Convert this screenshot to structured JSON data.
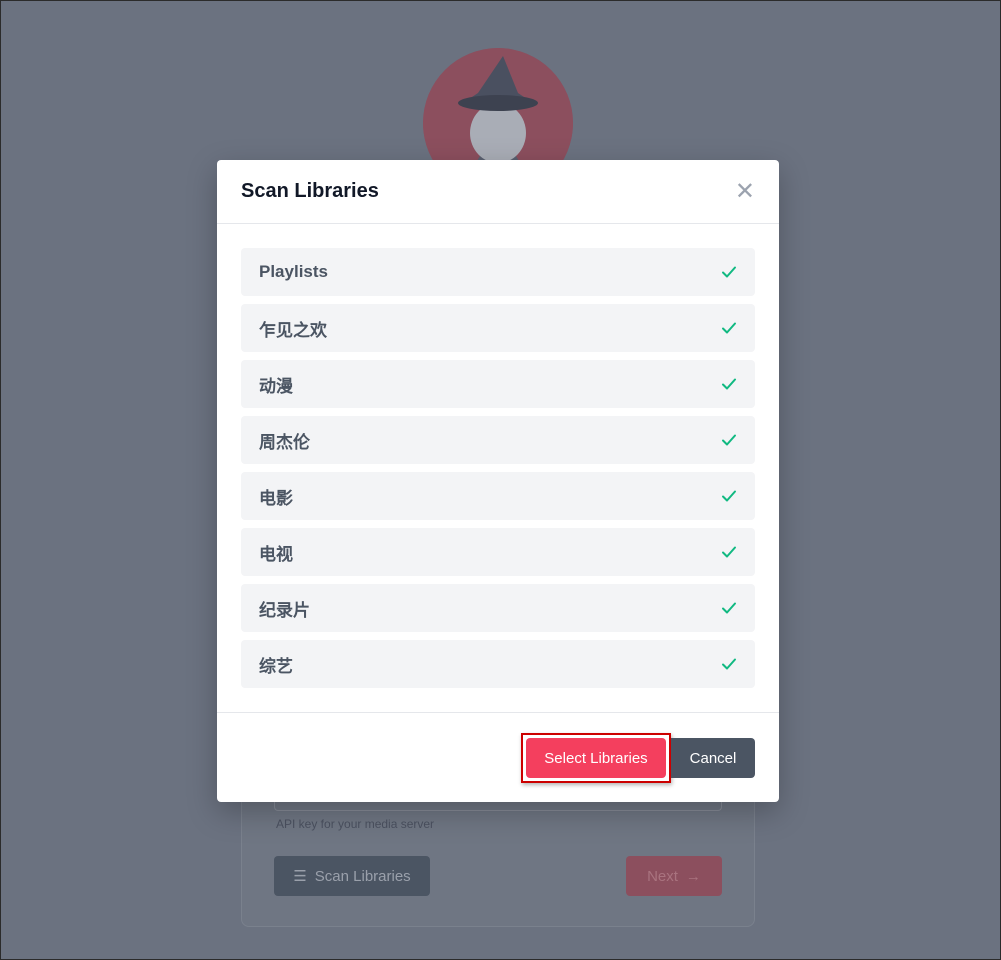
{
  "background": {
    "api_hint": "API key for your media server",
    "scan_button_label": "Scan Libraries",
    "next_button_label": "Next"
  },
  "modal": {
    "title": "Scan Libraries",
    "libraries": [
      {
        "label": "Playlists",
        "selected": true
      },
      {
        "label": "乍见之欢",
        "selected": true
      },
      {
        "label": "动漫",
        "selected": true
      },
      {
        "label": "周杰伦",
        "selected": true
      },
      {
        "label": "电影",
        "selected": true
      },
      {
        "label": "电视",
        "selected": true
      },
      {
        "label": "纪录片",
        "selected": true
      },
      {
        "label": "综艺",
        "selected": true
      }
    ],
    "select_button_label": "Select Libraries",
    "cancel_button_label": "Cancel"
  },
  "colors": {
    "accent": "#f43f5e",
    "check": "#10b981",
    "overlay": "#6b7280"
  },
  "icons": {
    "close": "close-icon",
    "check": "check-icon",
    "list": "list-icon",
    "arrow": "arrow-right-icon"
  }
}
